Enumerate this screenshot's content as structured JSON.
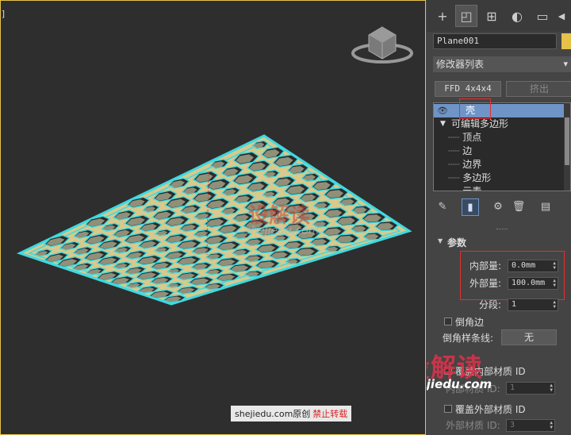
{
  "viewport": {
    "bracket": "]",
    "watermark_logo": "设解读",
    "watermark_url": "shejiedu.com",
    "footer_note": "shejiedu.com原创",
    "footer_note_red": "禁止转载"
  },
  "panel": {
    "tabs": [
      {
        "icon": "create-icon",
        "glyph": "+"
      },
      {
        "icon": "modify-icon",
        "glyph": "◰"
      },
      {
        "icon": "hierarchy-icon",
        "glyph": "⊞"
      },
      {
        "icon": "motion-icon",
        "glyph": "◐"
      },
      {
        "icon": "display-icon",
        "glyph": "▭"
      },
      {
        "icon": "utilities-icon",
        "glyph": "◀"
      }
    ],
    "object_name": "Plane001",
    "object_color": "#e6c24a",
    "modifier_list": "修改器列表",
    "dropdown_arrow": "▾",
    "button_ffd": "FFD 4x4x4",
    "button_extrude": "挤出",
    "stack": {
      "eye_glyph": "👁",
      "shell": "壳",
      "editable_poly": "可编辑多边形",
      "expand_glyph": "▼",
      "sub_items": [
        "顶点",
        "边",
        "边界",
        "多边形",
        "元素"
      ]
    },
    "toolbar_glyphs": {
      "pin": "✎",
      "show_end": "▮",
      "unique": "⚙",
      "remove": "🗑",
      "configure": "▤"
    },
    "rollout": {
      "title": "参数",
      "collapse_glyph": "▼",
      "inner_amount_label": "内部量:",
      "inner_amount_value": "0.0mm",
      "outer_amount_label": "外部量:",
      "outer_amount_value": "100.0mm",
      "segments_label": "分段:",
      "segments_value": "1",
      "bevel_edges_label": "倒角边",
      "bevel_spline_label": "倒角样条线:",
      "bevel_spline_button": "无",
      "override_inner_label": "覆盖内部材质 ID",
      "inner_mat_label": "内部材质 ID:",
      "inner_mat_value": "1",
      "override_outer_label": "覆盖外部材质 ID",
      "outer_mat_label": "外部材质 ID:",
      "outer_mat_value": "3"
    },
    "watermark_logo": "设解读",
    "watermark_url": "shejiedu.com"
  },
  "colors": {
    "viewport_bg": "#2e2e2e",
    "viewport_border": "#e6c24a",
    "mesh_fill": "#d8c98c",
    "mesh_hole": "#2b2b2b",
    "mesh_outline": "#3fd9e0",
    "selection_blue": "#6f94c7",
    "highlight_red": "#e03030"
  }
}
